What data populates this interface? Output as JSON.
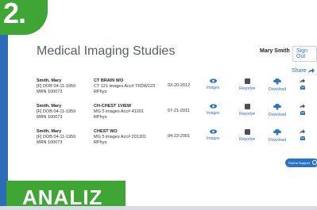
{
  "badge": {
    "number": "2."
  },
  "header": {
    "title": "Medical Imaging Studies",
    "user_name": "Mary Smith",
    "sign_out": "Sign Out"
  },
  "share": {
    "label": "Share"
  },
  "studies": [
    {
      "patient_name": "Smith, Mary",
      "dob": "[F] DOB 04-11-1959",
      "mrn": "MRN 100073",
      "study_title": "CT BRAIN WO",
      "study_detail": "CT 121 images  Acc# TFDW123",
      "physician": "RPhys:",
      "date": "03-20-2012"
    },
    {
      "patient_name": "Smith, Mary",
      "dob": "[F] DOB 04-11-1959",
      "mrn": "MRN 100073",
      "study_title": "CH-CHEST 1VIEW",
      "study_detail": "MG 5 images  Acc# 41201",
      "physician": "RPhys:",
      "date": "07-21-2011"
    },
    {
      "patient_name": "Smith, Mary",
      "dob": "[F] DOB 04-11-1959",
      "mrn": "MRN 100073",
      "study_title": "CHEST WO",
      "study_detail": "MG 5 images  Acc# 201201",
      "physician": "RPhys:",
      "date": "04-23-2001"
    }
  ],
  "actions": {
    "images": "Images",
    "reports": "Reports",
    "download": "Download"
  },
  "support": {
    "label": "Rodna Support"
  },
  "footer": {
    "text": "ANALIZ"
  },
  "colors": {
    "accent": "#2a74c6",
    "green": "#3fa535",
    "frame": "#2b6bb8"
  }
}
